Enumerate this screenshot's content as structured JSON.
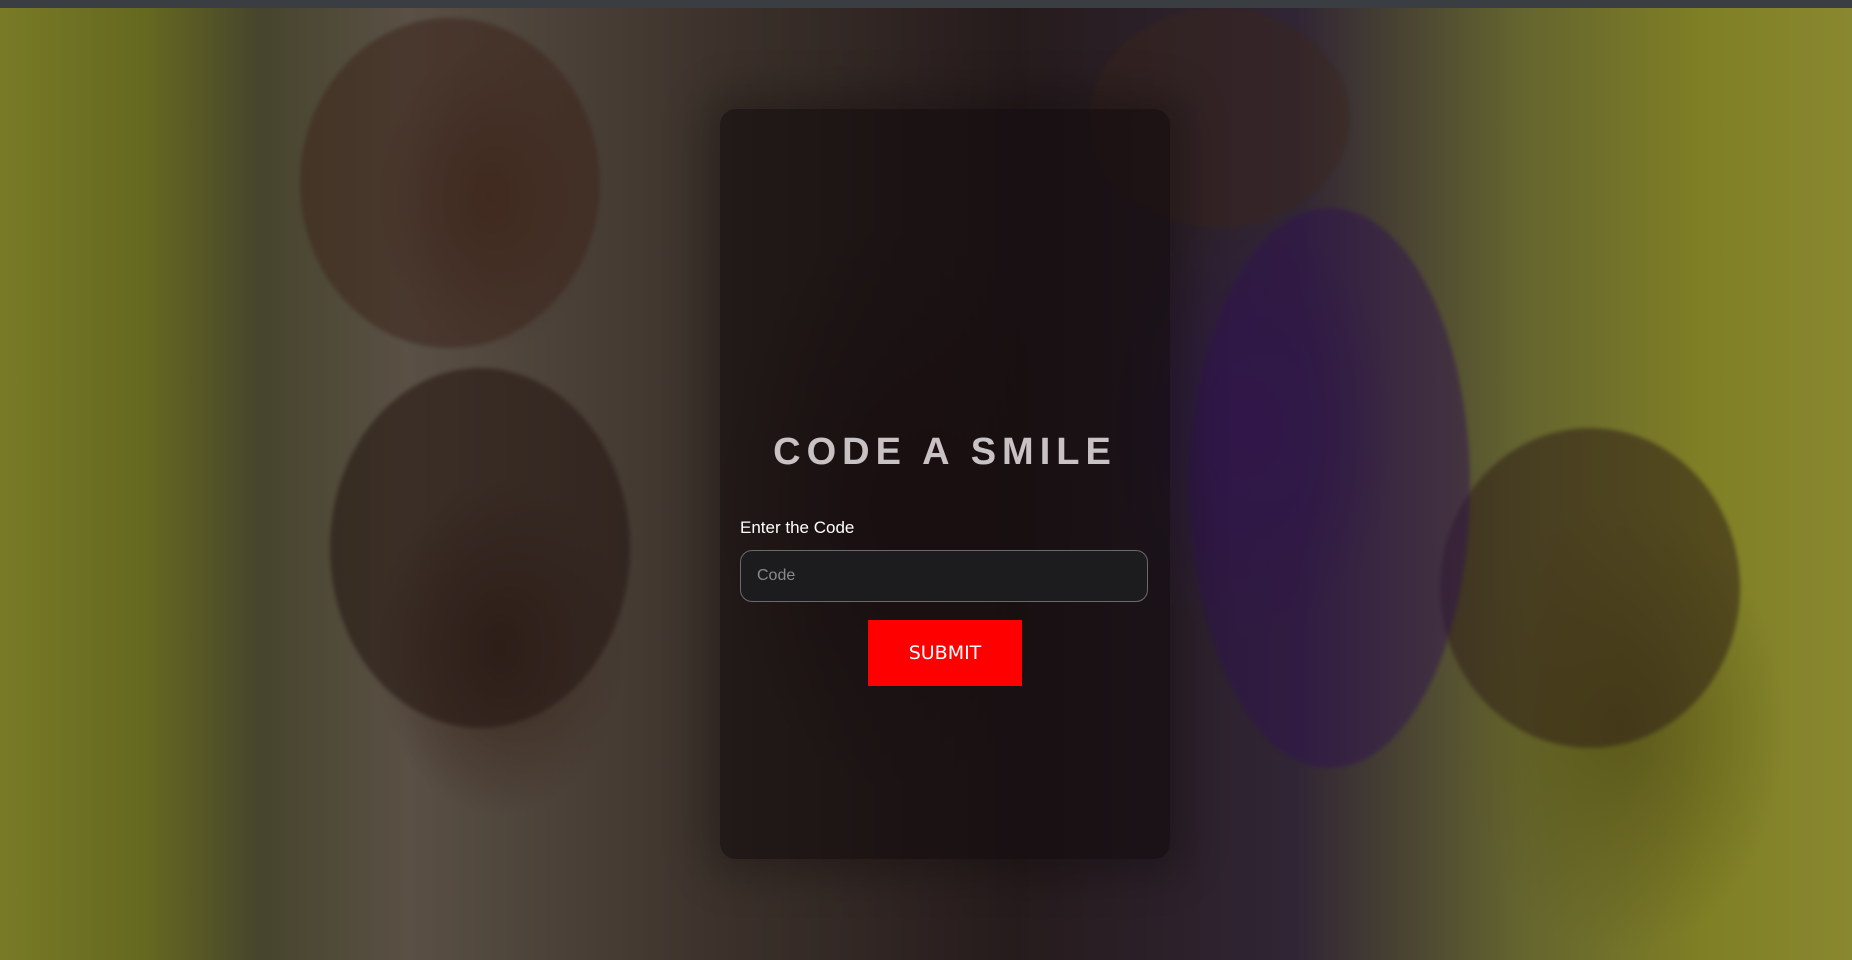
{
  "login": {
    "title": "CODE A SMILE",
    "code_label": "Enter the Code",
    "code_placeholder": "Code",
    "code_value": "",
    "submit_label": "SUBMIT"
  },
  "colors": {
    "submit_background": "#ff0000",
    "title_text": "#c9c2c4",
    "card_background": "rgba(12,8,10,0.55)"
  }
}
